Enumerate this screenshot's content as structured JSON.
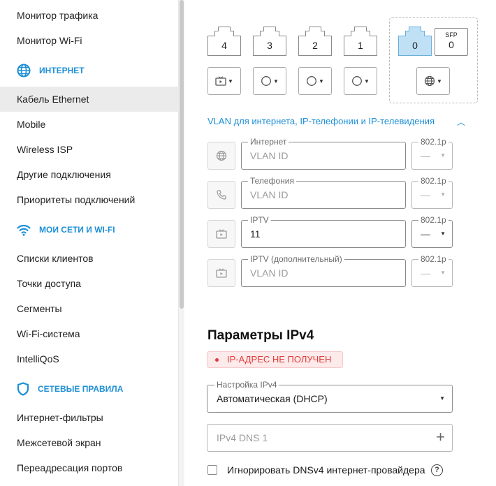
{
  "sidebar": {
    "items_top": [
      {
        "label": "Монитор трафика"
      },
      {
        "label": "Монитор Wi-Fi"
      }
    ],
    "section_internet": {
      "label": "ИНТЕРНЕТ",
      "icon": "globe-icon"
    },
    "items_internet": [
      {
        "label": "Кабель Ethernet",
        "active": true
      },
      {
        "label": "Mobile"
      },
      {
        "label": "Wireless ISP"
      },
      {
        "label": "Другие подключения"
      },
      {
        "label": "Приоритеты подключений"
      }
    ],
    "section_networks": {
      "label": "МОИ СЕТИ И WI-FI",
      "icon": "wifi-icon"
    },
    "items_networks": [
      {
        "label": "Списки клиентов"
      },
      {
        "label": "Точки доступа"
      },
      {
        "label": "Сегменты"
      },
      {
        "label": "Wi-Fi-система"
      },
      {
        "label": "IntelliQoS"
      }
    ],
    "section_rules": {
      "label": "СЕТЕВЫЕ ПРАВИЛА",
      "icon": "shield-icon"
    },
    "items_rules": [
      {
        "label": "Интернет-фильтры"
      },
      {
        "label": "Межсетевой экран"
      },
      {
        "label": "Переадресация портов"
      }
    ]
  },
  "ports": [
    {
      "num": "4",
      "mode_icon": "tv-icon"
    },
    {
      "num": "3",
      "mode_icon": "circle-icon"
    },
    {
      "num": "2",
      "mode_icon": "circle-icon"
    },
    {
      "num": "1",
      "mode_icon": "circle-icon"
    },
    {
      "num": "0",
      "mode_icon": "globe-icon",
      "selected": true
    }
  ],
  "sfp": {
    "label": "SFP",
    "num": "0"
  },
  "colors": {
    "accent": "#1d8fd6",
    "selected_port": "#bfe0f5",
    "error": "#e33b3b",
    "error_bg": "#fdeaea"
  },
  "vlan": {
    "toggle_label": "VLAN для интернета, IP-телефонии и IP-телевидения",
    "rows": [
      {
        "icon": "globe-icon",
        "legend": "Интернет",
        "value": "VLAN ID",
        "filled": false,
        "prio_legend": "802.1p",
        "prio_value": "—"
      },
      {
        "icon": "phone-icon",
        "legend": "Телефония",
        "value": "VLAN ID",
        "filled": false,
        "prio_legend": "802.1p",
        "prio_value": "—"
      },
      {
        "icon": "tv-icon",
        "legend": "IPTV",
        "value": "11",
        "filled": true,
        "prio_legend": "802.1p",
        "prio_value": "—"
      },
      {
        "icon": "tv-icon",
        "legend": "IPTV (дополнительный)",
        "value": "VLAN ID",
        "filled": false,
        "prio_legend": "802.1p",
        "prio_value": "—"
      }
    ]
  },
  "ipv4": {
    "title": "Параметры IPv4",
    "status": "IP-АДРЕС НЕ ПОЛУЧЕН",
    "setting_legend": "Настройка IPv4",
    "setting_value": "Автоматическая (DHCP)",
    "dns_placeholder": "IPv4 DNS 1",
    "ignore_label": "Игнорировать DNSv4 интернет-провайдера",
    "help": "?"
  }
}
